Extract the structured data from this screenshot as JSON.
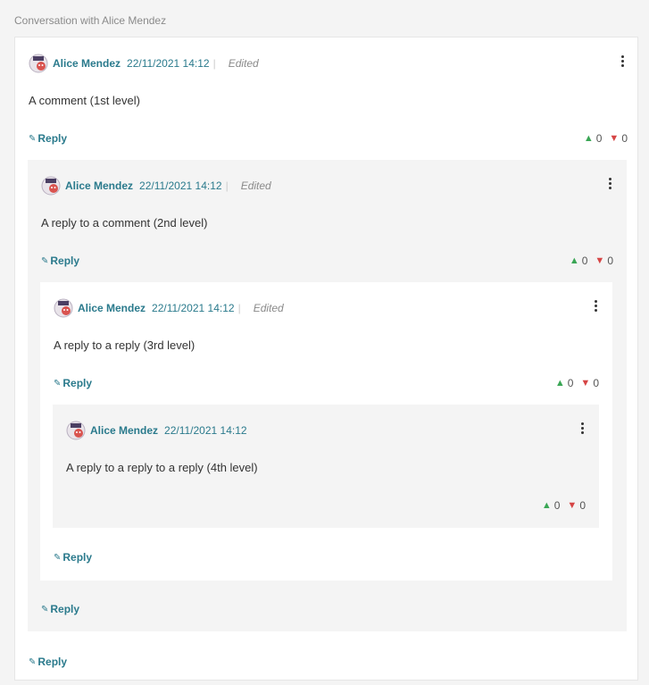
{
  "page": {
    "heading": "Conversation with Alice Mendez"
  },
  "colors": {
    "link": "#2a7a8c",
    "upvote": "#3aa655",
    "downvote": "#d64545",
    "nest_bg": "#f4f4f4"
  },
  "comments": [
    {
      "level": 1,
      "author": "Alice Mendez",
      "date": "22/11/2021 14:12",
      "edited": "Edited",
      "text": "A comment (1st level)",
      "reply": "Reply",
      "upvotes": "0",
      "downvotes": "0",
      "bottom_reply": "Reply"
    },
    {
      "level": 2,
      "author": "Alice Mendez",
      "date": "22/11/2021 14:12",
      "edited": "Edited",
      "text": "A reply to a comment (2nd level)",
      "reply": "Reply",
      "upvotes": "0",
      "downvotes": "0",
      "bottom_reply": "Reply"
    },
    {
      "level": 3,
      "author": "Alice Mendez",
      "date": "22/11/2021 14:12",
      "edited": "Edited",
      "text": "A reply to a reply (3rd level)",
      "reply": "Reply",
      "upvotes": "0",
      "downvotes": "0",
      "bottom_reply": "Reply"
    },
    {
      "level": 4,
      "author": "Alice Mendez",
      "date": "22/11/2021 14:12",
      "text": "A reply to a reply to a reply (4th level)",
      "upvotes": "0",
      "downvotes": "0"
    }
  ]
}
